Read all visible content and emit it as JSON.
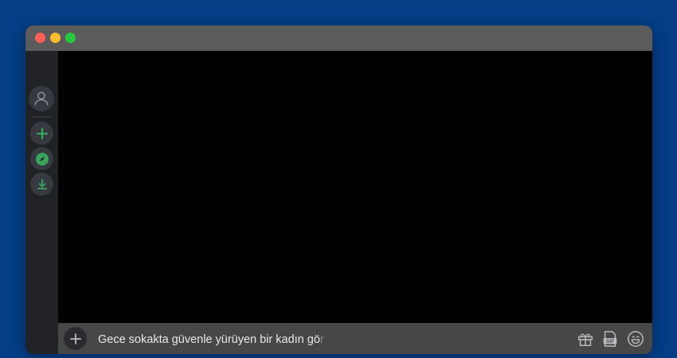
{
  "window": {
    "traffic_lights": [
      "close",
      "minimize",
      "zoom"
    ],
    "colors": {
      "close": "#ff5f57",
      "minimize": "#febc2e",
      "zoom": "#28c840",
      "accent": "#3ba55d"
    }
  },
  "sidebar": {
    "items": [
      {
        "name": "user-avatar",
        "icon": "user-icon"
      },
      {
        "name": "add-server",
        "icon": "plus-icon"
      },
      {
        "name": "explore",
        "icon": "compass-icon"
      },
      {
        "name": "download",
        "icon": "download-icon"
      }
    ]
  },
  "chat": {
    "input_text": "Gece sokakta güvenle yürüyen bir kadın gö",
    "input_text_faded": "r",
    "icons": [
      "gift-icon",
      "gif-icon",
      "emoji-icon"
    ],
    "gif_label": "GIF"
  }
}
